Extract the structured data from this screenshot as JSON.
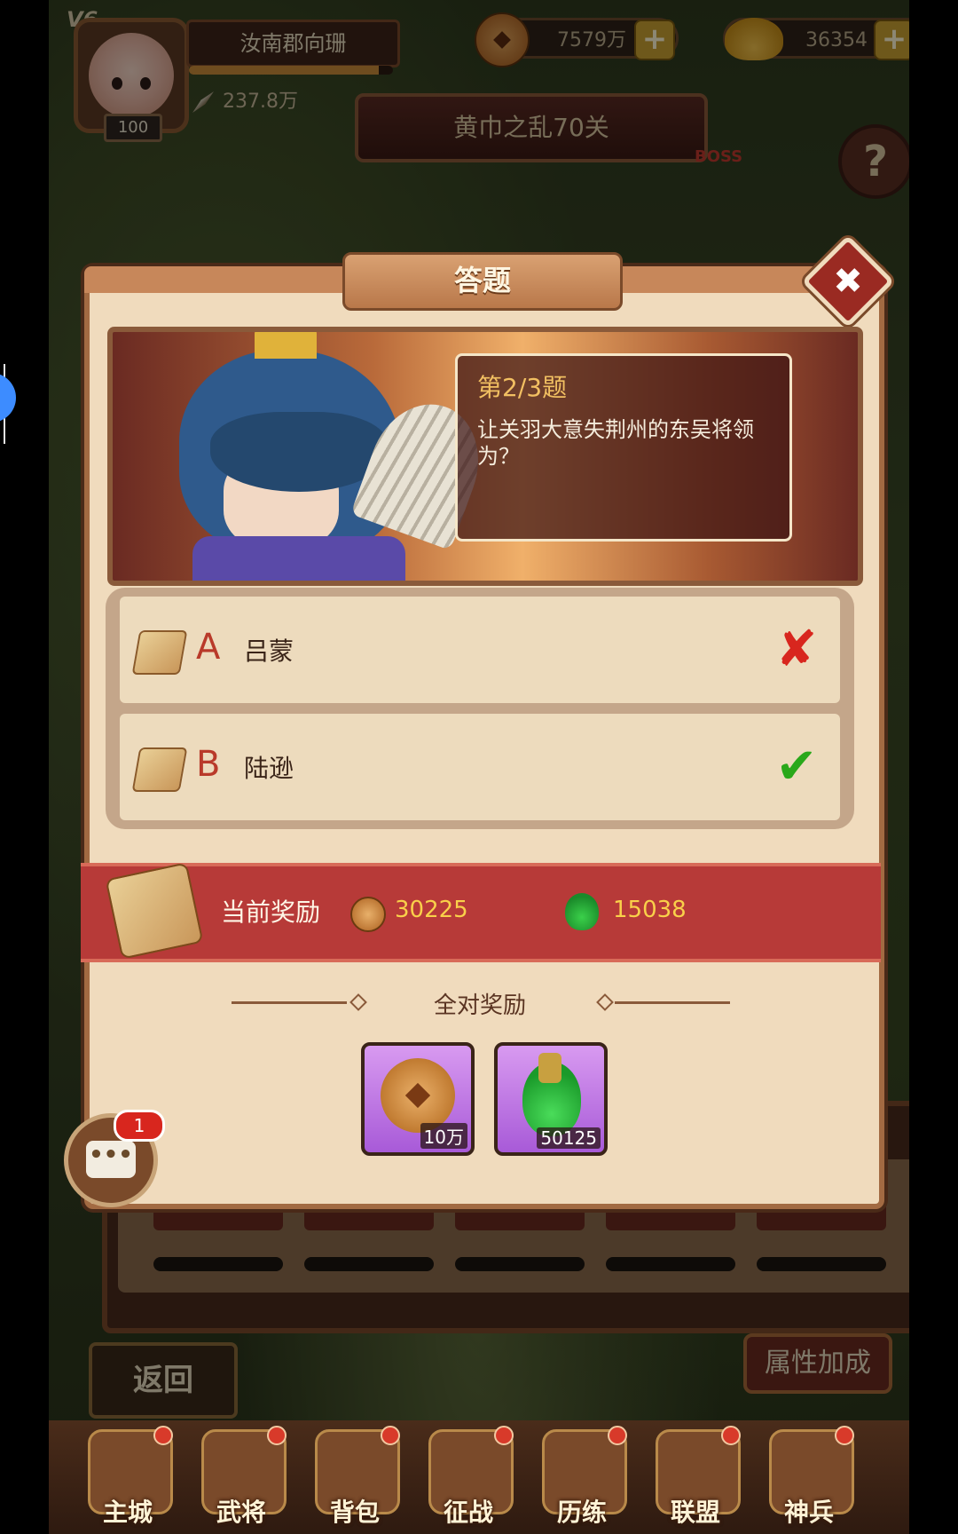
{
  "hud": {
    "vip": "V6",
    "player_name": "汝南郡向珊",
    "level": "100",
    "power": "237.8万",
    "exp_fraction": 0.93,
    "coins": "7579万",
    "ingots": "36354",
    "stage": "黄巾之乱70关",
    "boss_tag": "BOSS",
    "help": "?"
  },
  "quiz": {
    "title": "答题",
    "close": "✖",
    "question_number": "第2/3题",
    "question_text": "让关羽大意失荆州的东吴将领为？",
    "options": [
      {
        "letter": "A",
        "text": "吕蒙",
        "mark": "✘",
        "result": "wrong"
      },
      {
        "letter": "B",
        "text": "陆逊",
        "mark": "✔",
        "result": "correct"
      }
    ],
    "current_reward_label": "当前奖励",
    "current_reward_coins": "30225",
    "current_reward_potion": "15038",
    "full_reward_label": "全对奖励",
    "full_rewards": [
      {
        "icon": "coin-icon",
        "count": "10万"
      },
      {
        "icon": "potion-icon",
        "count": "50125"
      }
    ]
  },
  "chat": {
    "bubble": "•••",
    "badge": "1"
  },
  "bottom": {
    "back": "返回",
    "attr_bonus": "属性加成",
    "nav": [
      "主城",
      "武将",
      "背包",
      "征战",
      "历练",
      "联盟",
      "神兵"
    ]
  },
  "colors": {
    "accent_red": "#b73a38",
    "reward_yellow": "#f9d04a",
    "correct_green": "#2aa81a",
    "wrong_red": "#d8261e"
  }
}
